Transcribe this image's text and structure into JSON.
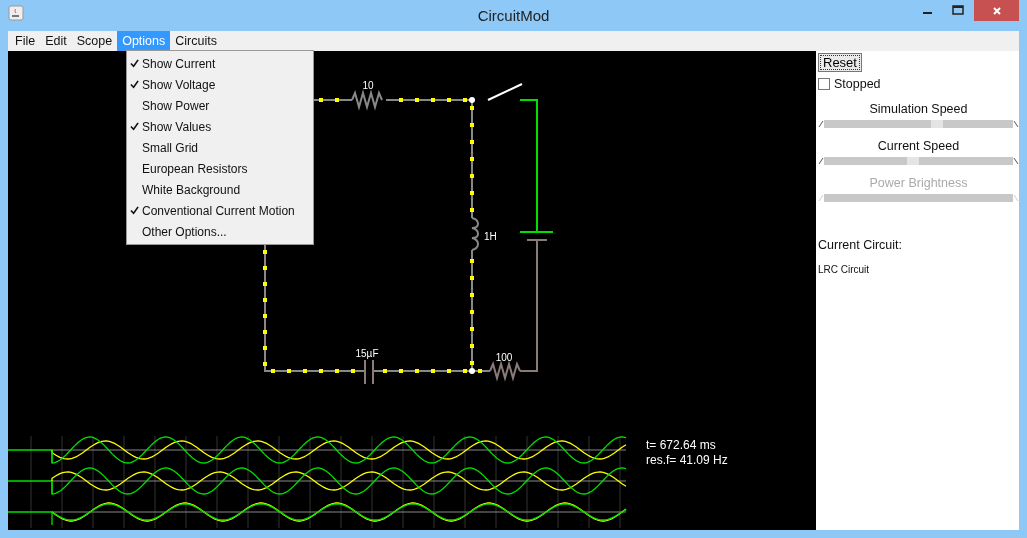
{
  "window": {
    "title": "CircuitMod"
  },
  "menu": [
    {
      "label": "File",
      "selected": false
    },
    {
      "label": "Edit",
      "selected": false
    },
    {
      "label": "Scope",
      "selected": false
    },
    {
      "label": "Options",
      "selected": true
    },
    {
      "label": "Circuits",
      "selected": false
    }
  ],
  "options_menu": [
    {
      "label": "Show Current",
      "checked": true
    },
    {
      "label": "Show Voltage",
      "checked": true
    },
    {
      "label": "Show Power",
      "checked": false
    },
    {
      "label": "Show Values",
      "checked": true
    },
    {
      "label": "Small Grid",
      "checked": false
    },
    {
      "label": "European Resistors",
      "checked": false
    },
    {
      "label": "White Background",
      "checked": false
    },
    {
      "label": "Conventional Current Motion",
      "checked": true
    },
    {
      "label": "Other Options...",
      "checked": false
    }
  ],
  "circuit": {
    "labels": [
      "10",
      "1H",
      "15µF",
      "100"
    ]
  },
  "scope": {
    "readings": [
      "t= 672.64 ms",
      "res.f= 41.09 Hz"
    ]
  },
  "panel": {
    "reset": "Reset",
    "stopped": {
      "label": "Stopped",
      "checked": false
    },
    "sliders": [
      {
        "label": "Simulation Speed",
        "level": 0.6,
        "disabled": false
      },
      {
        "label": "Current Speed",
        "level": 0.47,
        "disabled": false
      },
      {
        "label": "Power Brightness",
        "disabled": true
      }
    ],
    "circuit_heading": "Current Circuit:",
    "circuit_name": "LRC Circuit"
  }
}
